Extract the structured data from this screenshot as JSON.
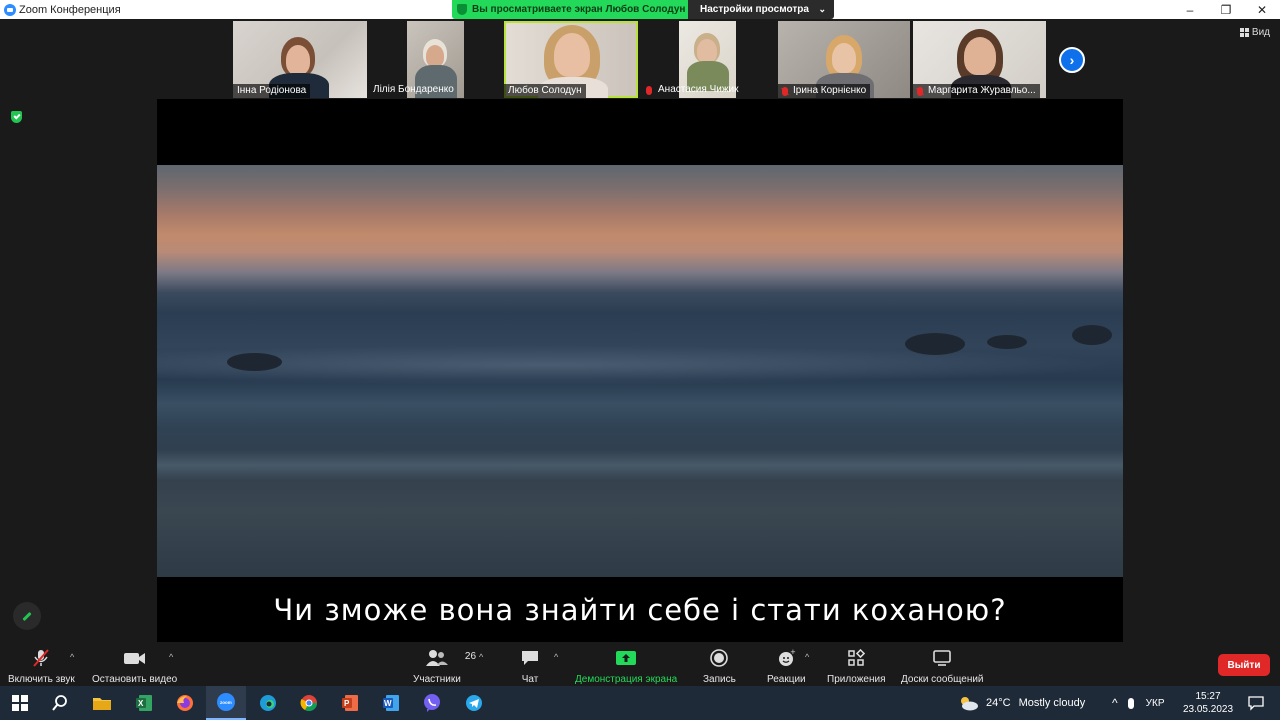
{
  "window": {
    "title": "Zoom Конференция",
    "controls": [
      "–",
      "❐",
      "✕"
    ]
  },
  "banner": {
    "viewing_text": "Вы просматриваете экран Любов Солодун",
    "settings_label": "Настройки просмотра"
  },
  "view_label": "Вид",
  "participants": [
    {
      "name": "Інна Родіонова",
      "muted": false
    },
    {
      "name": "Лілія Бондаренко",
      "muted": false
    },
    {
      "name": "Любов Солодун",
      "muted": false,
      "active": true
    },
    {
      "name": "Анастасия Чижик",
      "muted": true
    },
    {
      "name": "Ірина Корнієнко",
      "muted": true
    },
    {
      "name": "Маргарита Журавльо...",
      "muted": true
    }
  ],
  "shared_screen": {
    "subtitle": "Чи зможе вона знайти себе і стати коханою?"
  },
  "toolbar": {
    "unmute_label": "Включить звук",
    "stop_video_label": "Остановить видео",
    "participants_label": "Участники",
    "participants_count": "26",
    "chat_label": "Чат",
    "share_label": "Демонстрация экрана",
    "record_label": "Запись",
    "reactions_label": "Реакции",
    "apps_label": "Приложения",
    "whiteboards_label": "Доски сообщений",
    "leave_label": "Выйти"
  },
  "taskbar": {
    "weather_temp": "24°C",
    "weather_desc": "Mostly cloudy",
    "language": "УКР",
    "time": "15:27",
    "date": "23.05.2023"
  },
  "colors": {
    "share_green": "#23d959",
    "leave_red": "#e02828",
    "zoom_blue": "#0e71eb"
  }
}
